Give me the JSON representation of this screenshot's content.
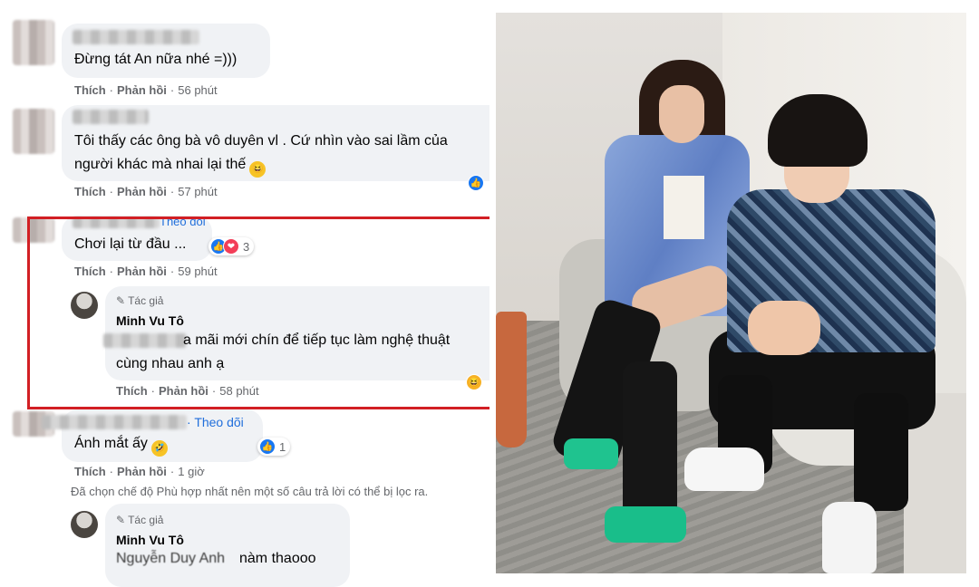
{
  "colors": {
    "link_blue": "#216fdb",
    "highlight_red": "#d21f24",
    "bubble_bg": "#f0f2f5",
    "meta_gray": "#65676b",
    "like_blue": "#1877f2",
    "love_red": "#f33e58",
    "haha_yellow": "#f7b125"
  },
  "actions": {
    "like": "Thích",
    "reply": "Phản hồi",
    "sep": "·"
  },
  "comments": [
    {
      "text": "Đừng tát An nữa nhé =)))",
      "time": "56 phút"
    },
    {
      "text_line1": "Tôi thấy các ông bà vô duyên vl . Cứ nhìn vào sai lầm của",
      "text_line2": "người khác mà nhai lại thế",
      "emoji": "haha-emoji",
      "time": "57 phút",
      "reaction_icon": "like-icon"
    },
    {
      "follow_partial": "Theo dõi",
      "text": "Chơi lại từ đầu ...",
      "reaction_count": "3",
      "time": "59 phút",
      "reply": {
        "author_tag": "Tác giả",
        "author_name": "Minh Vu Tô",
        "text_line1": "a mãi mới chín để tiếp tục làm nghệ thuật",
        "text_line2": "cùng nhau anh ạ",
        "emoji": "haha-emoji",
        "time": "58 phút"
      }
    },
    {
      "follow": "Theo dõi",
      "text": "Ánh mắt ấy",
      "emoji": "rofl-emoji",
      "reaction_count": "1",
      "time": "1 giờ"
    }
  ],
  "filter_note": "Đã chọn chế độ Phù hợp nhất nên một số câu trả lời có thể bị lọc ra.",
  "last_reply": {
    "author_tag": "Tác giả",
    "author_name": "Minh Vu Tô",
    "mention": "Nguyễn Duy Anh",
    "text": "nàm thaooo"
  }
}
